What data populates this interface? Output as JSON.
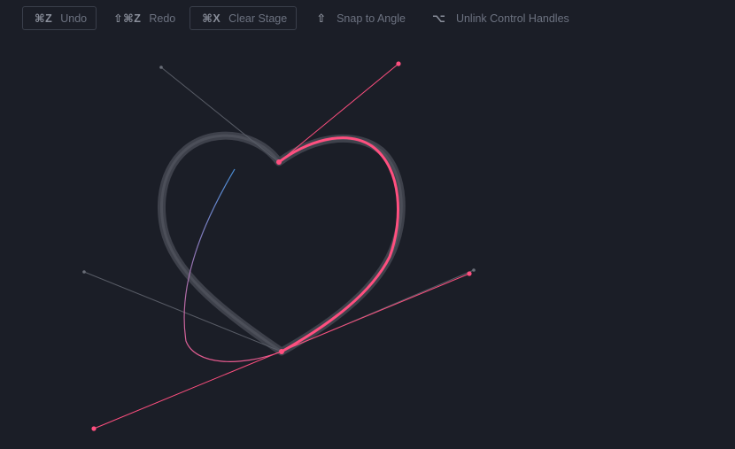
{
  "toolbar": {
    "undo": {
      "shortcut": "⌘Z",
      "label": "Undo"
    },
    "redo": {
      "shortcut": "⇧⌘Z",
      "label": "Redo"
    },
    "clear": {
      "shortcut": "⌘X",
      "label": "Clear Stage"
    },
    "snap": {
      "shortcut": "⇧",
      "label": "Snap to Angle"
    },
    "unlink": {
      "shortcut": "⌥",
      "label": "Unlink Control Handles"
    }
  },
  "colors": {
    "background": "#1b1e27",
    "accent_pink": "#ff4f7f",
    "guide_path": "#4a4d56",
    "handle_gray": "#585c66",
    "preview_blue": "#4a8fd8"
  }
}
